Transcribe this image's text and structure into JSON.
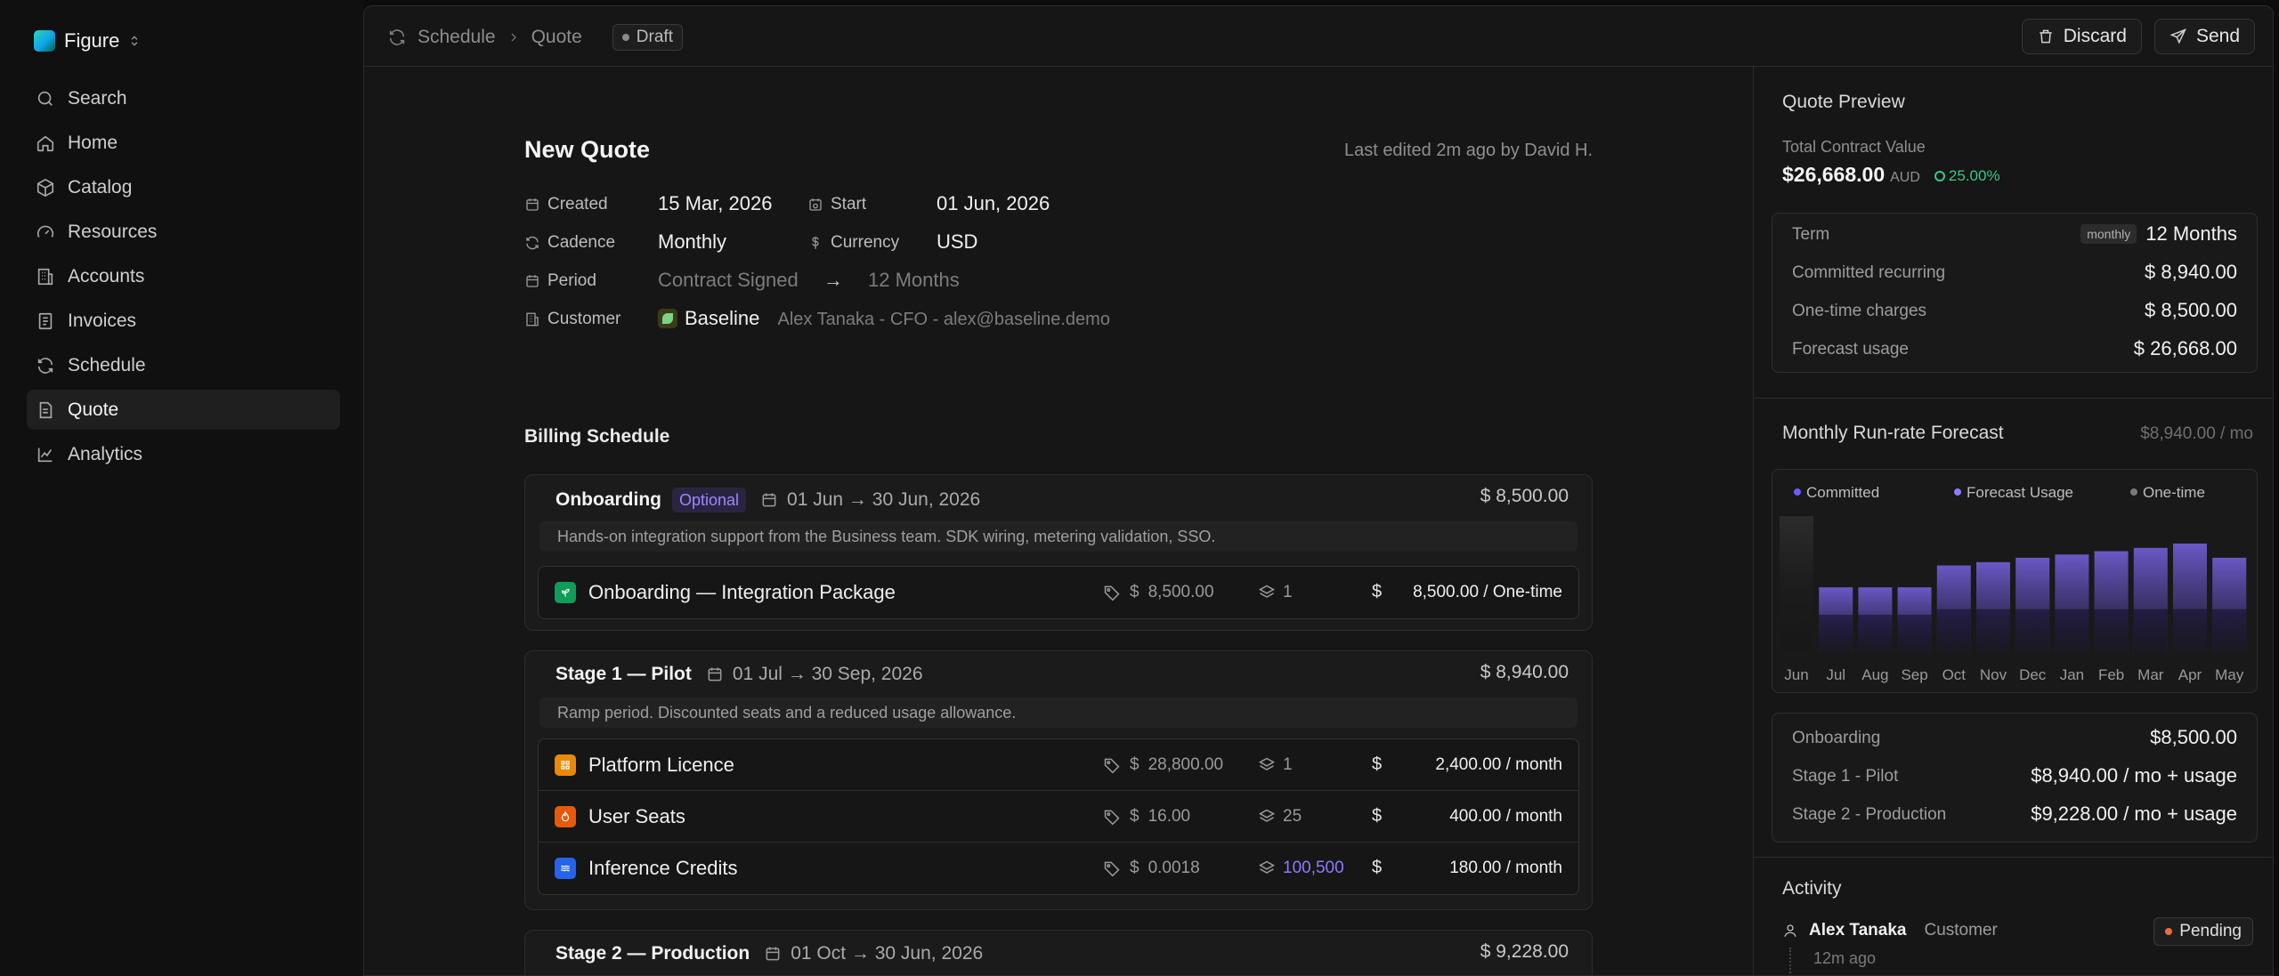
{
  "app": {
    "name": "Figure"
  },
  "sidebar": {
    "items": [
      {
        "label": "Search",
        "icon": "search-icon"
      },
      {
        "label": "Home",
        "icon": "home-icon"
      },
      {
        "label": "Catalog",
        "icon": "box-icon"
      },
      {
        "label": "Resources",
        "icon": "gauge-icon"
      },
      {
        "label": "Accounts",
        "icon": "building-icon"
      },
      {
        "label": "Invoices",
        "icon": "invoice-icon"
      },
      {
        "label": "Schedule",
        "icon": "refresh-icon"
      },
      {
        "label": "Quote",
        "icon": "document-icon",
        "active": true
      },
      {
        "label": "Analytics",
        "icon": "chart-line-icon"
      }
    ]
  },
  "topbar": {
    "crumb_1": "Schedule",
    "crumb_2": "Quote",
    "status": "Draft",
    "discard_label": "Discard",
    "send_label": "Send"
  },
  "quote": {
    "title": "New Quote",
    "last_edited": "Last edited 2m ago by David H.",
    "created_label": "Created",
    "created_value": "15 Mar, 2026",
    "start_label": "Start",
    "start_value": "01 Jun, 2026",
    "cadence_label": "Cadence",
    "cadence_value": "Monthly",
    "currency_label": "Currency",
    "currency_value": "USD",
    "period_label": "Period",
    "period_from": "Contract Signed",
    "period_arrow": "→",
    "period_to": "12 Months",
    "customer_label": "Customer",
    "customer_name": "Baseline",
    "customer_contact": "Alex Tanaka - CFO - alex@baseline.demo"
  },
  "billing": {
    "title": "Billing Schedule",
    "stages": [
      {
        "name": "Onboarding",
        "optional": "Optional",
        "dates": "01 Jun → 30 Jun, 2026",
        "amount": "$ 8,500.00",
        "description": "Hands-on integration support from the Business team. SDK wiring, metering validation, SSO.",
        "lines": [
          {
            "name": "Onboarding — Integration Package",
            "icon_color": "#0f9d58",
            "price": "8,500.00",
            "qty": "1",
            "total": "8,500.00 / One-time"
          }
        ]
      },
      {
        "name": "Stage 1 — Pilot",
        "dates": "01 Jul → 30 Sep, 2026",
        "amount": "$ 8,940.00",
        "description": "Ramp period. Discounted seats and a reduced usage allowance.",
        "lines": [
          {
            "name": "Platform Licence",
            "icon_color": "#e8890c",
            "price": "28,800.00",
            "qty": "1",
            "total": "2,400.00 / month"
          },
          {
            "name": "User Seats",
            "icon_color": "#e8590c",
            "price": "16.00",
            "qty": "25",
            "total": "400.00 / month"
          },
          {
            "name": "Inference Credits",
            "icon_color": "#2563eb",
            "price": "0.0018",
            "qty": "100,500",
            "total": "180.00 / month"
          }
        ]
      },
      {
        "name": "Stage 2 — Production",
        "dates": "01 Oct → 30 Jun, 2026",
        "amount": "$ 9,228.00"
      }
    ]
  },
  "preview": {
    "title": "Quote Preview",
    "tcv_label": "Total Contract Value",
    "tcv_value": "$26,668.00",
    "tcv_currency": "AUD",
    "tcv_change": "25.00%",
    "term_label": "Term",
    "term_badge": "monthly",
    "term_value": "12 Months",
    "committed_label": "Committed recurring",
    "committed_value": "$ 8,940.00",
    "onetime_label": "One-time charges",
    "onetime_value": "$ 8,500.00",
    "forecast_label": "Forecast usage",
    "forecast_value": "$ 26,668.00",
    "forecast_title": "Monthly Run-rate Forecast",
    "forecast_subtitle": "$8,940.00 / mo",
    "stage_summary": [
      {
        "label": "Onboarding",
        "value": "$8,500.00"
      },
      {
        "label": "Stage 1 - Pilot",
        "value": "$8,940.00 / mo + usage"
      },
      {
        "label": "Stage 2 - Production",
        "value": "$9,228.00 / mo + usage"
      }
    ],
    "activity_title": "Activity",
    "activity": {
      "name": "Alex Tanaka",
      "role": "Customer",
      "time": "12m ago",
      "status": "Pending"
    }
  },
  "colors": {
    "committed": "#5a4aa8",
    "forecast": "#7a67d8",
    "onetime": "#3a3a3a",
    "accent_green": "#35c98a",
    "pending": "#f26b3a"
  },
  "chart_data": {
    "type": "bar",
    "categories": [
      "Jun",
      "Jul",
      "Aug",
      "Sep",
      "Oct",
      "Nov",
      "Dec",
      "Jan",
      "Feb",
      "Mar",
      "Apr",
      "May"
    ],
    "series": [
      {
        "name": "Committed",
        "values": [
          0,
          35,
          35,
          35,
          40,
          40,
          40,
          40,
          40,
          40,
          40,
          40
        ]
      },
      {
        "name": "Forecast Usage",
        "values": [
          0,
          25,
          25,
          25,
          40,
          43,
          47,
          50,
          53,
          56,
          60,
          47
        ]
      },
      {
        "name": "One-time",
        "values": [
          125,
          0,
          0,
          0,
          0,
          0,
          0,
          0,
          0,
          0,
          0,
          0
        ]
      }
    ],
    "legend": [
      "Committed",
      "Forecast Usage",
      "One-time"
    ],
    "stacked": true,
    "ylim": [
      0,
      130
    ]
  }
}
